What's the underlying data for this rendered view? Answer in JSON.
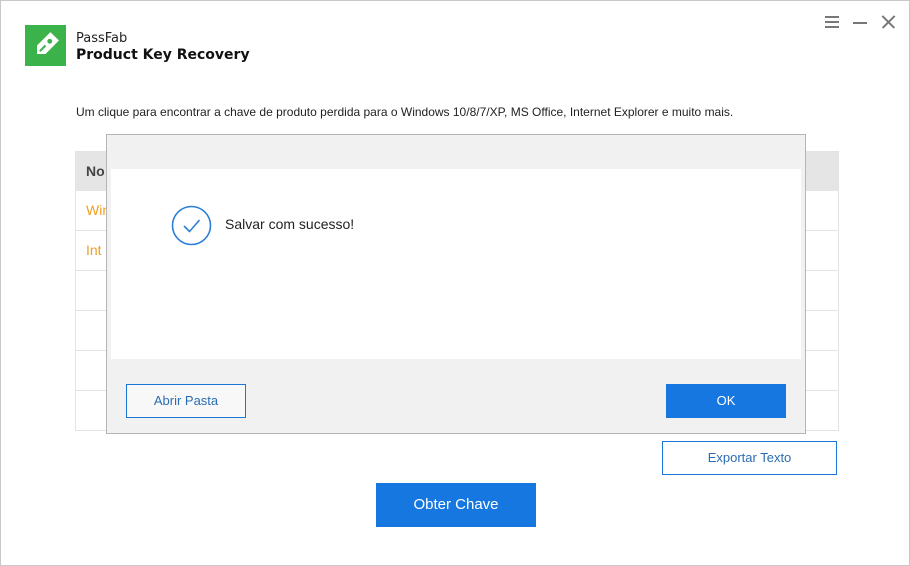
{
  "header": {
    "brand": "PassFab",
    "product": "Product Key Recovery",
    "logo_icon": "key-tag-icon",
    "accent_color": "#3cb24a"
  },
  "window_controls": [
    "menu-icon",
    "minimize-icon",
    "close-icon"
  ],
  "tagline": "Um clique para encontrar a chave de produto perdida para o Windows 10/8/7/XP, MS Office, Internet Explorer e muito mais.",
  "table": {
    "header": "No",
    "rows": [
      "Win",
      "Int",
      "",
      "",
      "",
      ""
    ]
  },
  "buttons": {
    "export": "Exportar Texto",
    "obtain": "Obter Chave"
  },
  "dialog": {
    "message": "Salvar com sucesso!",
    "status_icon": "check-circle-icon",
    "open_folder": "Abrir Pasta",
    "ok": "OK"
  },
  "colors": {
    "primary": "#1777e0",
    "row_text": "#f0a020"
  }
}
